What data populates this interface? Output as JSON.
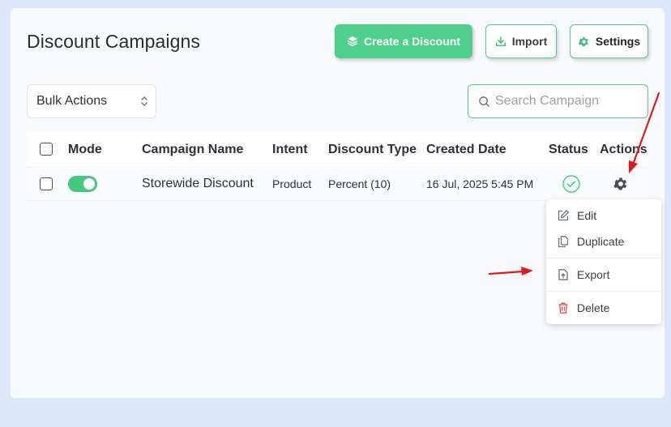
{
  "header": {
    "title": "Discount Campaigns",
    "create_label": "Create a Discount",
    "import_label": "Import",
    "settings_label": "Settings"
  },
  "toolbar": {
    "bulk_actions": {
      "selected": "Bulk Actions"
    },
    "search": {
      "placeholder": "Search Campaign",
      "value": ""
    }
  },
  "table": {
    "columns": [
      "Mode",
      "Campaign Name",
      "Intent",
      "Discount Type",
      "Created Date",
      "Status",
      "Actions"
    ],
    "rows": [
      {
        "mode_enabled": true,
        "campaign_name": "Storewide Discount",
        "intent": "Product",
        "discount_type": "Percent (10)",
        "created_date": "16 Jul, 2025 5:45 PM",
        "status_icon": "check-circle-icon",
        "actions_icon": "gear-icon"
      }
    ]
  },
  "actions_menu": {
    "items": [
      {
        "label": "Edit",
        "icon": "edit-icon"
      },
      {
        "label": "Duplicate",
        "icon": "duplicate-icon"
      },
      {
        "label": "Export",
        "icon": "export-icon"
      },
      {
        "label": "Delete",
        "icon": "trash-icon"
      }
    ]
  },
  "colors": {
    "accent_green": "#4fcf8c",
    "annotation_red": "#e01b1b",
    "delete_red": "#e0524f"
  }
}
